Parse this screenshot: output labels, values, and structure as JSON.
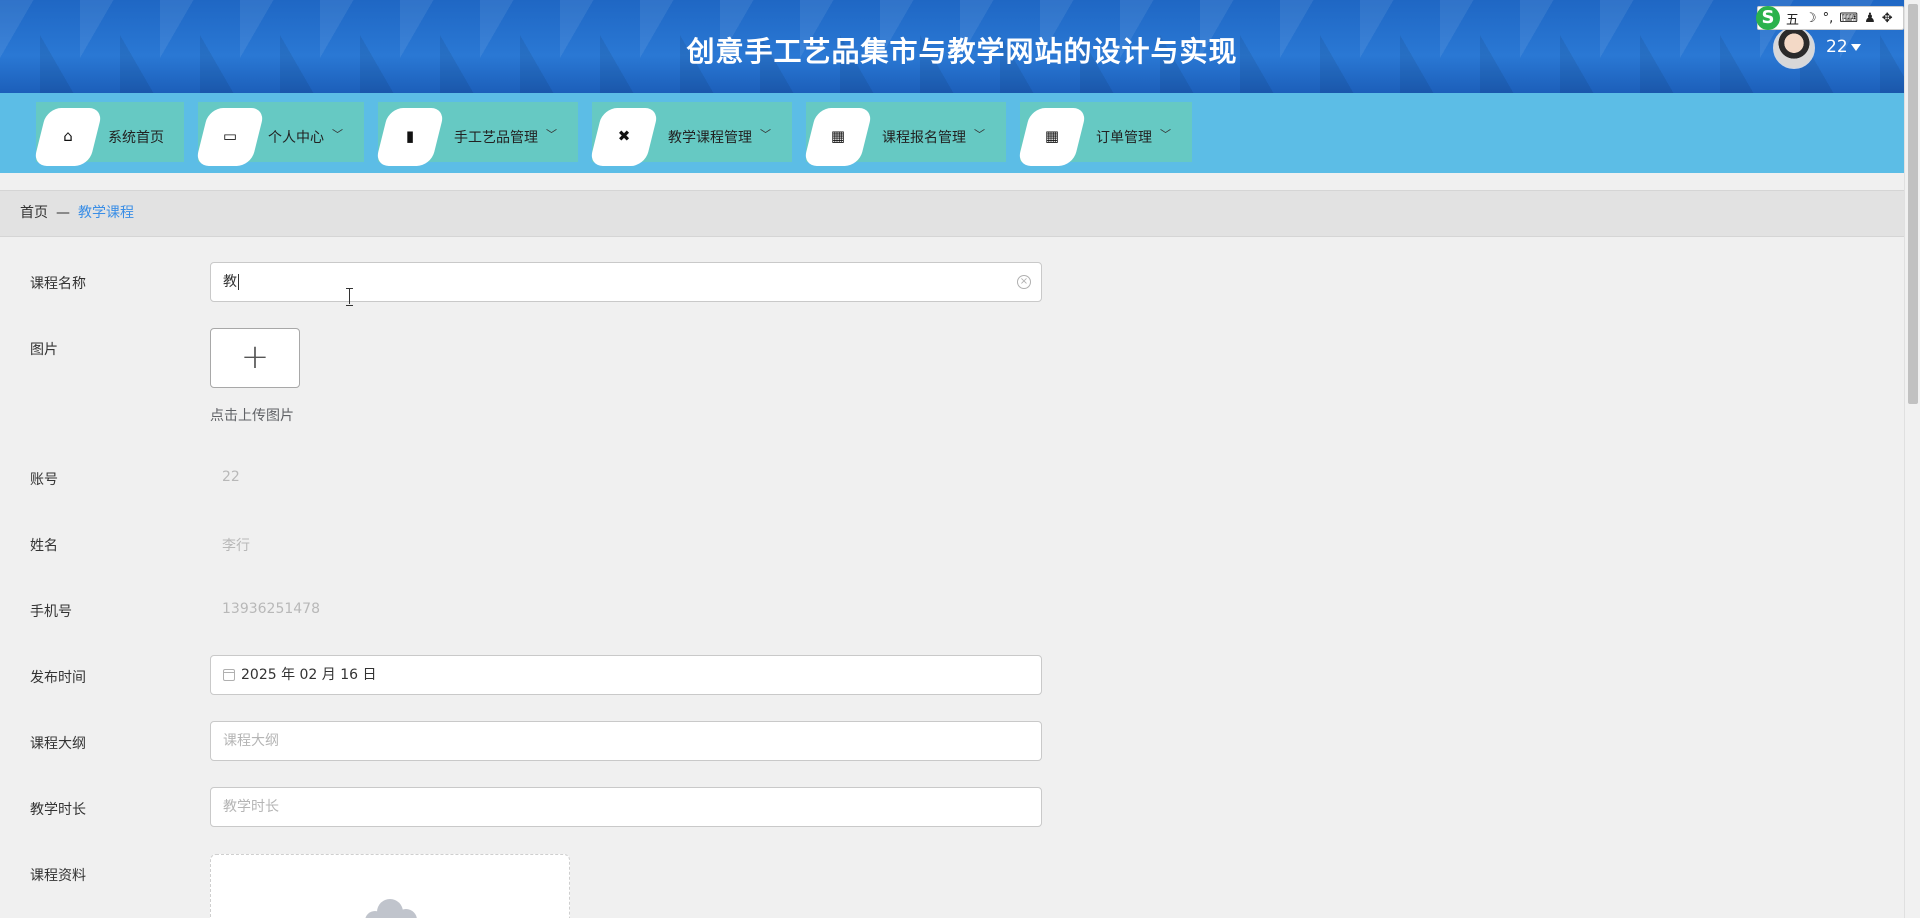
{
  "header": {
    "title": "创意手工艺品集市与教学网站的设计与实现",
    "username": "22"
  },
  "ime": {
    "logo": "S",
    "mode": "五",
    "items": [
      "☽",
      "°,",
      "⌨",
      "♟",
      "✥"
    ]
  },
  "nav": [
    {
      "label": "系统首页",
      "icon": "home-icon",
      "glyph": "⌂",
      "dropdown": false
    },
    {
      "label": "个人中心",
      "icon": "wallet-icon",
      "glyph": "▭",
      "dropdown": true
    },
    {
      "label": "手工艺品管理",
      "icon": "clipboard-icon",
      "glyph": "▮",
      "dropdown": true
    },
    {
      "label": "教学课程管理",
      "icon": "video-icon",
      "glyph": "✖",
      "dropdown": true
    },
    {
      "label": "课程报名管理",
      "icon": "grid-icon",
      "glyph": "▦",
      "dropdown": true
    },
    {
      "label": "订单管理",
      "icon": "grid-icon",
      "glyph": "▦",
      "dropdown": true
    }
  ],
  "breadcrumb": {
    "home": "首页",
    "separator": "—",
    "current": "教学课程"
  },
  "form": {
    "course_name": {
      "label": "课程名称",
      "value": "教"
    },
    "image": {
      "label": "图片",
      "plus": "+",
      "hint": "点击上传图片"
    },
    "account": {
      "label": "账号",
      "value": "22"
    },
    "name": {
      "label": "姓名",
      "value": "李行"
    },
    "phone": {
      "label": "手机号",
      "value": "13936251478"
    },
    "publish_time": {
      "label": "发布时间",
      "value": "2025 年 02 月 16 日"
    },
    "outline": {
      "label": "课程大纲",
      "placeholder": "课程大纲"
    },
    "duration": {
      "label": "教学时长",
      "placeholder": "教学时长"
    },
    "materials": {
      "label": "课程资料"
    }
  },
  "colors": {
    "header": "#2a78d4",
    "navbar": "#5cbde6",
    "nav_item": "#66c9c3",
    "link": "#3a8ee6"
  }
}
